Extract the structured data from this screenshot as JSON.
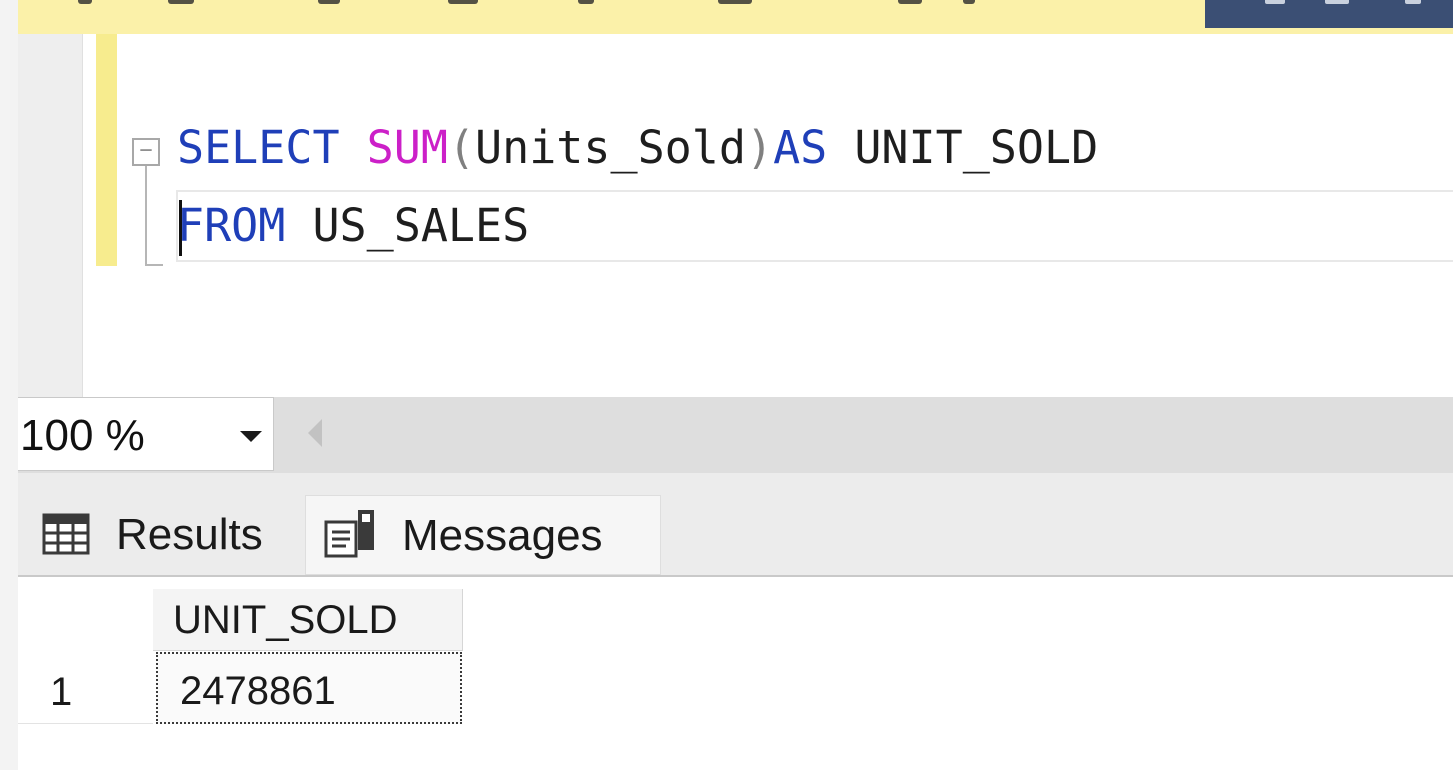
{
  "editor": {
    "line1": {
      "kw_select": "SELECT",
      "fn_sum": "SUM",
      "paren_open": "(",
      "arg": "Units_Sold",
      "paren_close": ")",
      "kw_as": "AS",
      "alias": " UNIT_SOLD"
    },
    "line2": {
      "kw_from": "FROM",
      "table": " US_SALES"
    }
  },
  "zoom": {
    "value": "100 %"
  },
  "tabs": [
    {
      "label": "Results",
      "icon": "grid-icon",
      "active": true
    },
    {
      "label": "Messages",
      "icon": "messages-icon",
      "active": false
    }
  ],
  "results": {
    "columns": [
      "UNIT_SOLD"
    ],
    "rows": [
      {
        "num": "1",
        "values": [
          "2478861"
        ]
      }
    ]
  },
  "colors": {
    "keyword": "#1f3fb8",
    "function": "#cc20c8",
    "operator": "#808080",
    "change_bar": "#f7ec8e"
  }
}
